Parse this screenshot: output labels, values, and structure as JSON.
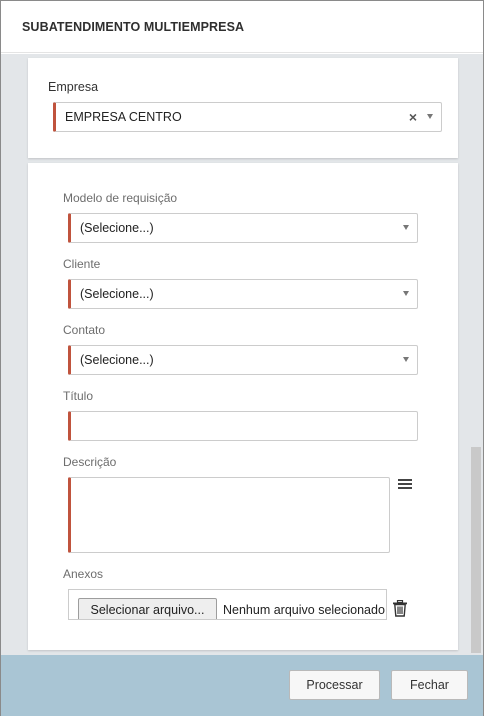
{
  "dialog": {
    "title": "SUBATENDIMENTO MULTIEMPRESA"
  },
  "empresa": {
    "label": "Empresa",
    "value": "EMPRESA CENTRO",
    "clear_symbol": "×"
  },
  "form": {
    "modelo": {
      "label": "Modelo de requisição",
      "value": "(Selecione...)"
    },
    "cliente": {
      "label": "Cliente",
      "value": "(Selecione...)"
    },
    "contato": {
      "label": "Contato",
      "value": "(Selecione...)"
    },
    "titulo": {
      "label": "Título",
      "value": ""
    },
    "descricao": {
      "label": "Descrição",
      "value": ""
    },
    "anexos": {
      "label": "Anexos",
      "button_label": "Selecionar arquivo...",
      "status_text": "Nenhum arquivo selecionado."
    }
  },
  "footer": {
    "process_label": "Processar",
    "close_label": "Fechar"
  },
  "colors": {
    "required_accent": "#c0533d",
    "footer_bg": "#a9c5d4",
    "body_bg": "#e3e6e9"
  },
  "icons": {
    "descricao_menu": "hamburger-menu-icon",
    "anexos_delete": "trash-icon",
    "select_caret": "caret-down-icon",
    "clear": "close-icon"
  }
}
